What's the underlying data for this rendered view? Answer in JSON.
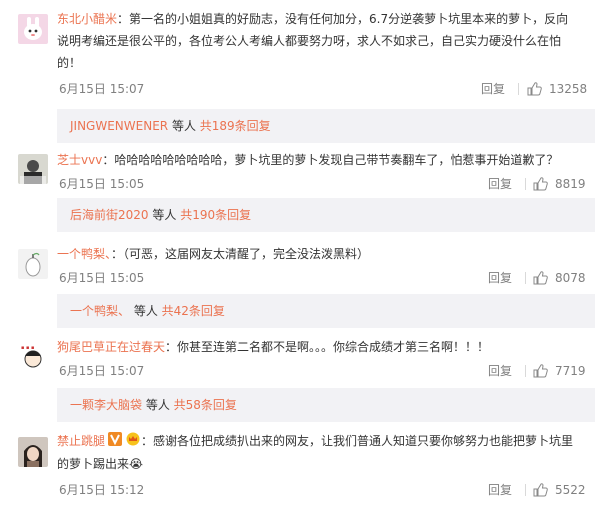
{
  "comments": [
    {
      "username": "东北小醋米",
      "text_lines": [
        "：第一名的小姐姐真的好励志，没有任何加分，6.7分逆袭萝卜坑里本来的萝卜，反向",
        "说明考编还是很公平的，各位考公人考编人都要努力呀，求人不如求己，自己实力硬没什么在怕",
        "的！"
      ],
      "date": "6月15日 15:07",
      "reply_label": "回复",
      "likes": "13258",
      "sub": {
        "user": "JINGWENWENER",
        "mid": " 等人 ",
        "more": "共189条回复"
      }
    },
    {
      "username": "芝士vvv",
      "text_lines": [
        "：哈哈哈哈哈哈哈哈哈，萝卜坑里的萝卜发现自己带节奏翻车了，怕惹事开始道歉了？"
      ],
      "date": "6月15日 15:05",
      "reply_label": "回复",
      "likes": "8819",
      "sub": {
        "user": "后海前街2020",
        "mid": " 等人 ",
        "more": "共190条回复"
      }
    },
    {
      "username": "一个鸭梨、",
      "text_lines": [
        "：（可恶，这届网友太清醒了，完全没法泼黑料）"
      ],
      "date": "6月15日 15:05",
      "reply_label": "回复",
      "likes": "8078",
      "sub": {
        "user": "一个鸭梨、",
        "mid": " 等人 ",
        "more": "共42条回复"
      }
    },
    {
      "username": "狗尾巴草正在过春天",
      "text_lines": [
        "：你甚至连第二名都不是啊。。。你综合成绩才第三名啊！！！"
      ],
      "date": "6月15日 15:07",
      "reply_label": "回复",
      "likes": "7719",
      "sub": {
        "user": "一颗李大脑袋",
        "mid": " 等人 ",
        "more": "共58条回复"
      }
    },
    {
      "username": "禁止跳腿",
      "text_lines": [
        "：感谢各位把成绩扒出来的网友，让我们普通人知道只要你够努力也能把萝卜坑里",
        "的萝卜踢出来😭"
      ],
      "date": "6月15日 15:12",
      "reply_label": "回复",
      "likes": "5522"
    }
  ],
  "colors": {
    "username": "#eb7350",
    "meta": "#808080",
    "sub_bg": "#f2f2f5",
    "text": "#333333"
  },
  "icons": {
    "like": "thumbs-up-icon",
    "vip": "vip-badge-icon",
    "crown": "crown-badge-icon"
  }
}
